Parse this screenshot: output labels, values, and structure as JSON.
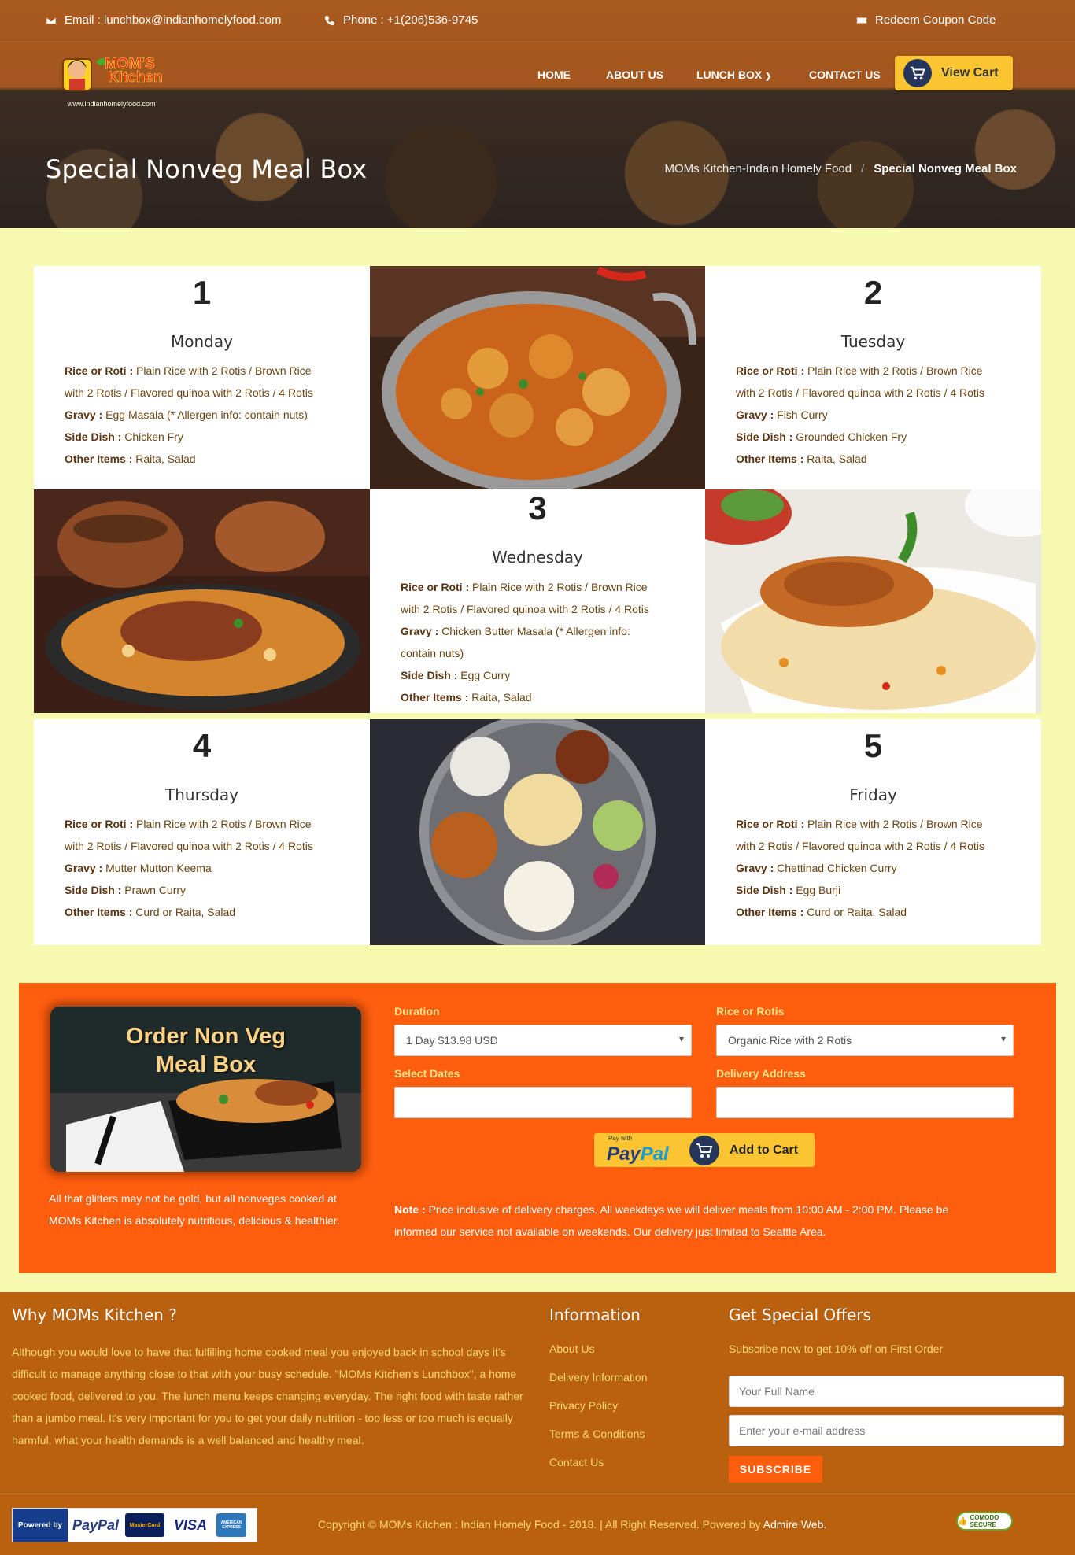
{
  "topbar": {
    "email": "Email : lunchbox@indianhomelyfood.com",
    "phone": "Phone : +1(206)536-9745",
    "coupon": "Redeem Coupon Code"
  },
  "logo": {
    "brand_line1": "MOM'S",
    "brand_line2": "Kitchen",
    "url": "www.indianhomelyfood.com"
  },
  "nav": {
    "home": "HOME",
    "about": "ABOUT US",
    "lunchbox": "LUNCH BOX",
    "contact": "CONTACT US",
    "cart": "View Cart"
  },
  "page": {
    "title": "Special Nonveg Meal Box",
    "breadcrumb_home": "MOMs Kitchen-Indain Homely Food",
    "breadcrumb_sep": "/",
    "breadcrumb_current": "Special Nonveg Meal Box"
  },
  "labels": {
    "rice": "Rice or Roti :",
    "gravy": "Gravy :",
    "side": "Side Dish :",
    "other": "Other Items :"
  },
  "days": [
    {
      "num": "1",
      "day": "Monday",
      "rice_a": "Plain Rice with 2 Rotis / Brown Rice",
      "rice_b": "with 2 Rotis / Flavored quinoa with 2 Rotis / 4 Rotis",
      "gravy": "Egg Masala (* Allergen info: contain nuts)",
      "side": "Chicken Fry",
      "other": "Raita, Salad"
    },
    {
      "num": "2",
      "day": "Tuesday",
      "rice_a": "Plain Rice with 2 Rotis / Brown Rice",
      "rice_b": "with 2 Rotis / Flavored quinoa with 2 Rotis / 4 Rotis",
      "gravy": "Fish Curry",
      "side": "Grounded Chicken Fry",
      "other": "Raita, Salad"
    },
    {
      "num": "3",
      "day": "Wednesday",
      "rice_a": "Plain Rice with 2 Rotis / Brown Rice",
      "rice_b": "with 2 Rotis / Flavored quinoa with 2 Rotis / 4 Rotis",
      "gravy_a": "Chicken Butter Masala (* Allergen info:",
      "gravy_b": "contain nuts)",
      "side": "Egg Curry",
      "other": "Raita, Salad"
    },
    {
      "num": "4",
      "day": "Thursday",
      "rice_a": "Plain Rice with 2 Rotis / Brown Rice",
      "rice_b": "with 2 Rotis / Flavored quinoa with 2 Rotis / 4 Rotis",
      "gravy": "Mutter Mutton Keema",
      "side": "Prawn Curry",
      "other": "Curd or Raita, Salad"
    },
    {
      "num": "5",
      "day": "Friday",
      "rice_a": "Plain Rice with 2 Rotis / Brown Rice",
      "rice_b": "with 2 Rotis / Flavored quinoa with 2 Rotis / 4 Rotis",
      "gravy": "Chettinad Chicken Curry",
      "side": "Egg Burji",
      "other": "Curd or Raita, Salad"
    }
  ],
  "order": {
    "image_title_1": "Order Non Veg",
    "image_title_2": "Meal Box",
    "tagline": "All that glitters may not be gold, but all nonveges cooked at MOMs Kitchen is absolutely nutritious, delicious & healthier.",
    "duration_label": "Duration",
    "duration_value": "1 Day $13.98 USD",
    "rice_label": "Rice or Rotis",
    "rice_value": "Organic Rice with 2 Rotis",
    "dates_label": "Select Dates",
    "address_label": "Delivery Address",
    "paypal_pay_with": "Pay with",
    "paypal_pay": "Pay",
    "paypal_pal": "Pal",
    "add_to_cart": "Add to Cart",
    "note_label": "Note :",
    "note_text": "Price inclusive of delivery charges. All weekdays we will deliver meals from 10:00 AM - 2:00 PM. Please be informed our service not available on weekends. Our delivery just limited to Seattle Area."
  },
  "footer": {
    "why_title": "Why MOMs Kitchen ?",
    "why_text": "Although you would love to have that fulfilling home cooked meal you enjoyed back in school days it's difficult to manage anything close to that with your busy schedule. \"MOMs Kitchen's Lunchbox\", a home cooked food, delivered to you. The lunch menu keeps changing everyday. The right food with taste rather than a jumbo meal. It's very important for you to get your daily nutrition - too less or too much is equally harmful, what your health demands is a well balanced and healthy meal.",
    "info_title": "Information",
    "info_links": [
      "About Us",
      "Delivery Information",
      "Privacy Policy",
      "Terms & Conditions",
      "Contact Us"
    ],
    "offers_title": "Get Special Offers",
    "offers_text": "Subscribe now to get 10% off on First Order",
    "name_placeholder": "Your Full Name",
    "email_placeholder": "Enter your e-mail address",
    "subscribe": "SUBSCRIBE",
    "powered_by": "Powered by",
    "paypal": "PayPal",
    "mastercard": "MasterCard",
    "visa": "VISA",
    "amex": "AMERICAN EXPRESS",
    "copyright": "Copyright © MOMs Kitchen : Indian Homely Food - 2018. | All Right Reserved. Powered by",
    "powered_link": "Admire Web.",
    "comodo": "COMODO SECURE"
  },
  "colors": {
    "accent_orange": "#ff5e0e",
    "cart_yellow": "#fbc531",
    "footer_brown": "#b9610e",
    "page_bg": "#f6f9b0"
  }
}
